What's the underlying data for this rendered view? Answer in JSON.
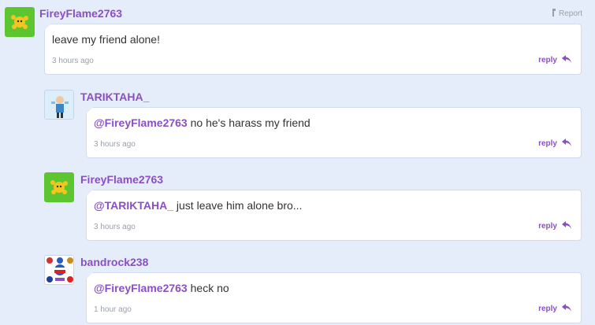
{
  "report_label": "Report",
  "reply_label": "reply",
  "comments": [
    {
      "username": "FireyFlame2763",
      "mention": "",
      "text": "leave my friend alone!",
      "time": "3 hours ago"
    },
    {
      "username": "TARIKTAHA_",
      "mention": "@FireyFlame2763",
      "text": " no he's harass my friend",
      "time": "3 hours ago"
    },
    {
      "username": "FireyFlame2763",
      "mention": "@TARIKTAHA_",
      "text": " just leave him alone bro...",
      "time": "3 hours ago"
    },
    {
      "username": "bandrock238",
      "mention": "@FireyFlame2763",
      "text": " heck no",
      "time": "1 hour ago"
    }
  ]
}
